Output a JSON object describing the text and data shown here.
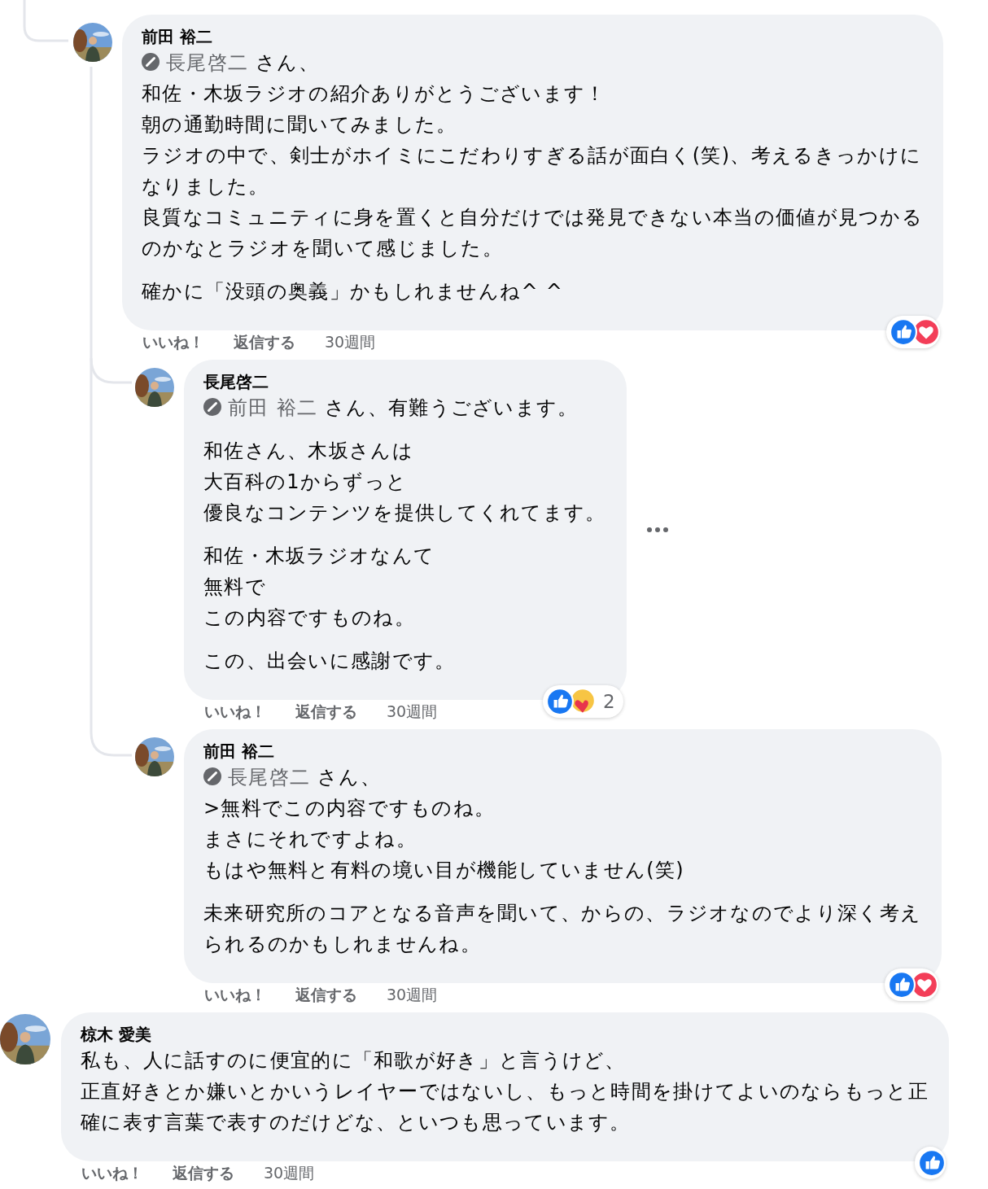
{
  "replies": [
    {
      "author": "前田 裕二",
      "paragraphs": [
        {
          "mention": "長尾啓二",
          "lines": [
            " さん、",
            "和佐・木坂ラジオの紹介ありがとうございます！",
            "朝の通勤時間に聞いてみました。",
            "ラジオの中で、剣士がホイミにこだわりすぎる話が面白く(笑)、考えるきっかけに",
            "なりました。",
            "良質なコミュニティに身を置くと自分だけでは発見できない本当の価値が見つかる",
            "のかなとラジオを聞いて感じました。"
          ]
        },
        {
          "lines": [
            "確かに「没頭の奥義」かもしれませんね^ ^"
          ]
        }
      ],
      "reactions": [
        {
          "kind": "like"
        },
        {
          "kind": "love"
        }
      ],
      "actions": [
        "いいね！",
        "返信する"
      ],
      "time": "30週間",
      "children": [
        {
          "author": "長尾啓二",
          "paragraphs": [
            {
              "mention": "前田 裕二",
              "lines": [
                " さん、有難うございます。"
              ]
            },
            {
              "lines": [
                "和佐さん、木坂さんは",
                "大百科の1からずっと",
                "優良なコンテンツを提供してくれてます。"
              ]
            },
            {
              "lines": [
                "和佐・木坂ラジオなんて",
                "無料で",
                "この内容ですものね。"
              ]
            },
            {
              "lines": [
                "この、出会いに感謝です。"
              ]
            }
          ],
          "more": true,
          "reactions": [
            {
              "kind": "like"
            },
            {
              "kind": "care"
            }
          ],
          "count": "2",
          "actions": [
            "いいね！",
            "返信する"
          ],
          "time": "30週間"
        },
        {
          "author": "前田 裕二",
          "paragraphs": [
            {
              "mention": "長尾啓二",
              "lines": [
                " さん、",
                ">無料でこの内容ですものね。",
                "まさにそれですよね。",
                "もはや無料と有料の境い目が機能していません(笑)"
              ]
            },
            {
              "lines": [
                "未来研究所のコアとなる音声を聞いて、からの、ラジオなのでより深く考え",
                "られるのかもしれませんね。"
              ]
            }
          ],
          "reactions": [
            {
              "kind": "like"
            },
            {
              "kind": "love"
            }
          ],
          "actions": [
            "いいね！",
            "返信する"
          ],
          "time": "30週間"
        }
      ]
    }
  ],
  "comments": [
    {
      "author": "椋木 愛美",
      "paragraphs": [
        {
          "lines": [
            "私も、人に話すのに便宜的に「和歌が好き」と言うけど、",
            "正直好きとか嫌いとかいうレイヤーではないし、もっと時間を掛けてよいのならもっと正",
            "確に表す言葉で表すのだけどな、といつも思っています。"
          ]
        }
      ],
      "reactions": [
        {
          "kind": "like"
        }
      ],
      "actions": [
        "いいね！",
        "返信する"
      ],
      "time": "30週間"
    }
  ]
}
